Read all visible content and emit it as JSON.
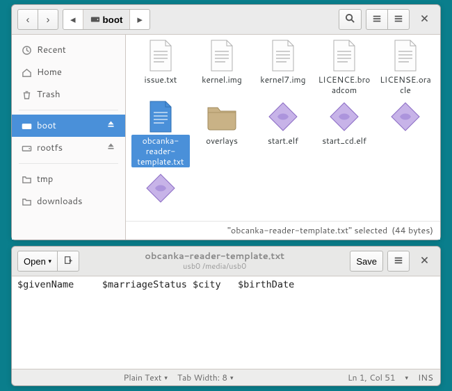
{
  "fm": {
    "path": {
      "current": "boot"
    },
    "sidebar": {
      "places": [
        {
          "id": "recent",
          "label": "Recent",
          "icon": "clock"
        },
        {
          "id": "home",
          "label": "Home",
          "icon": "home"
        },
        {
          "id": "trash",
          "label": "Trash",
          "icon": "trash"
        }
      ],
      "devices": [
        {
          "id": "boot",
          "label": "boot",
          "icon": "drive",
          "ejectable": true,
          "selected": true
        },
        {
          "id": "rootfs",
          "label": "rootfs",
          "icon": "drive",
          "ejectable": true
        }
      ],
      "bookmarks": [
        {
          "id": "tmp",
          "label": "tmp",
          "icon": "folder"
        },
        {
          "id": "downloads",
          "label": "downloads",
          "icon": "folder"
        }
      ]
    },
    "files": [
      {
        "name": "issue.txt",
        "type": "text"
      },
      {
        "name": "kernel.img",
        "type": "bin"
      },
      {
        "name": "kernel7.img",
        "type": "bin"
      },
      {
        "name": "LICENCE.broadcom",
        "type": "text"
      },
      {
        "name": "LICENSE.oracle",
        "type": "text"
      },
      {
        "name": "obcanka-reader-template.txt",
        "type": "text",
        "selected": true
      },
      {
        "name": "overlays",
        "type": "folder"
      },
      {
        "name": "start.elf",
        "type": "elf"
      },
      {
        "name": "start_cd.elf",
        "type": "elf"
      },
      {
        "name": "",
        "type": "elf"
      },
      {
        "name": "",
        "type": "elf"
      }
    ],
    "status": {
      "selection": "\"obcanka-reader-template.txt\" selected",
      "size": "(44 bytes)"
    }
  },
  "editor": {
    "open_label": "Open",
    "save_label": "Save",
    "title": "obcanka-reader-template.txt",
    "subtitle": "usb0 /media/usb0",
    "content": "$givenName     $marriageStatus $city   $birthDate",
    "status": {
      "syntax": "Plain Text",
      "tabwidth": "Tab Width: 8",
      "position": "Ln 1, Col 51",
      "mode": "INS"
    }
  }
}
